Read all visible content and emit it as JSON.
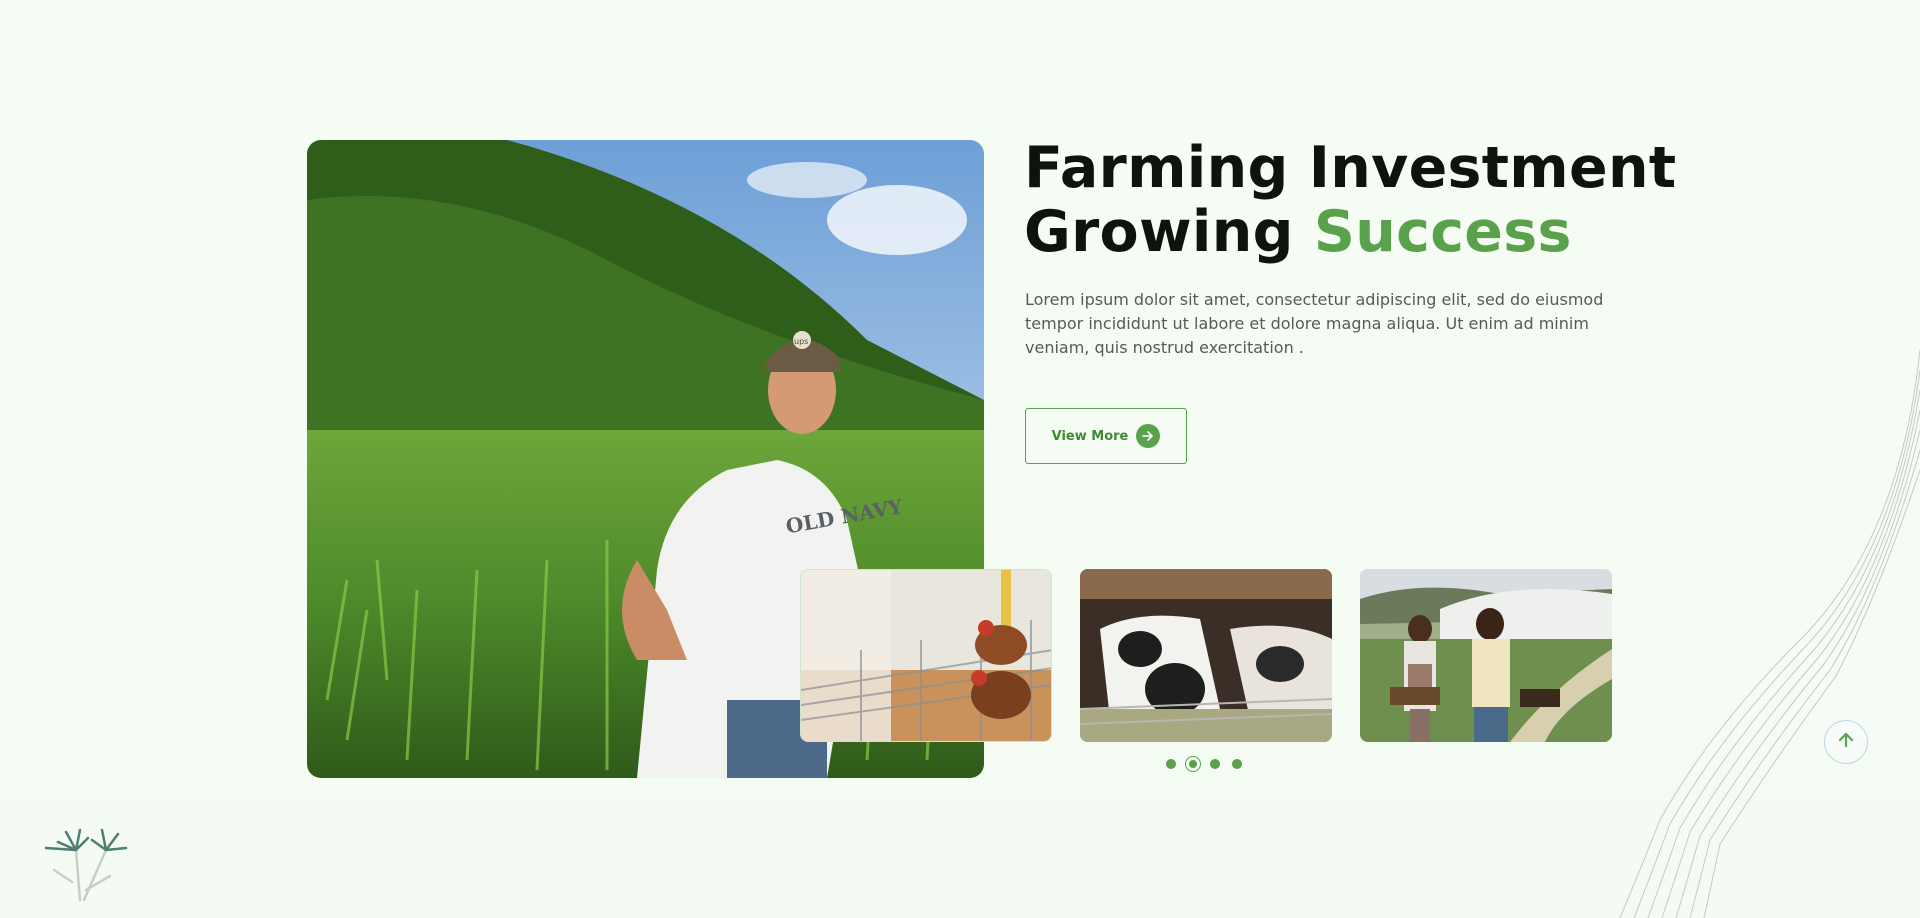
{
  "hero": {
    "title_line1": "Farming Investment",
    "title_line2_plain": "Growing ",
    "title_line2_accent": "Success",
    "description": "Lorem ipsum dolor sit amet, consectetur adipiscing elit, sed do eiusmod tempor incididunt ut labore et dolore magna aliqua. Ut enim ad minim veniam, quis nostrud exercitation .",
    "button_label": "View More",
    "button_icon": "arrow-right-icon",
    "main_image": "farmer-in-corn-field",
    "main_image_cap_text": "ups",
    "main_image_shirt_text": "OLD NAVY"
  },
  "thumbnails": [
    {
      "image": "chickens-in-coop",
      "active": true
    },
    {
      "image": "dairy-cows-feeding",
      "active": false
    },
    {
      "image": "women-carrying-vegetable-crates",
      "active": false
    }
  ],
  "pagination": {
    "count": 4,
    "active_index": 1
  },
  "scroll_top": {
    "icon": "arrow-up-icon"
  },
  "colors": {
    "accent": "#5aa14c",
    "title": "#0d1410",
    "text": "#555b57",
    "background": "#f5fdf5"
  }
}
